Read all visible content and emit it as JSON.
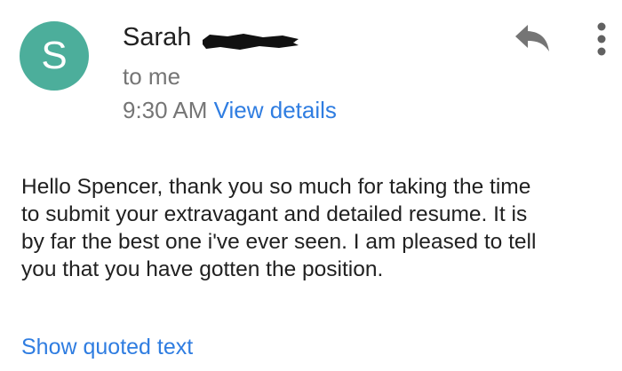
{
  "header": {
    "avatar_letter": "S",
    "avatar_color": "#4cae9b",
    "sender_name": "Sarah",
    "recipient": "to me",
    "time": "9:30 AM",
    "view_details_label": "View details",
    "reply_icon": "reply-icon",
    "more_icon": "more-vertical-icon"
  },
  "message": {
    "body_lines": [
      "Hello Spencer, thank you so much for taking the time",
      "to submit your extravagant and detailed resume. It is",
      "by far the best one i've ever seen. I am pleased to tell",
      "you that you have gotten the position."
    ],
    "show_quoted_label": "Show quoted text"
  },
  "colors": {
    "link": "#2f7de1",
    "secondary_text": "#757575",
    "primary_text": "#212121"
  }
}
